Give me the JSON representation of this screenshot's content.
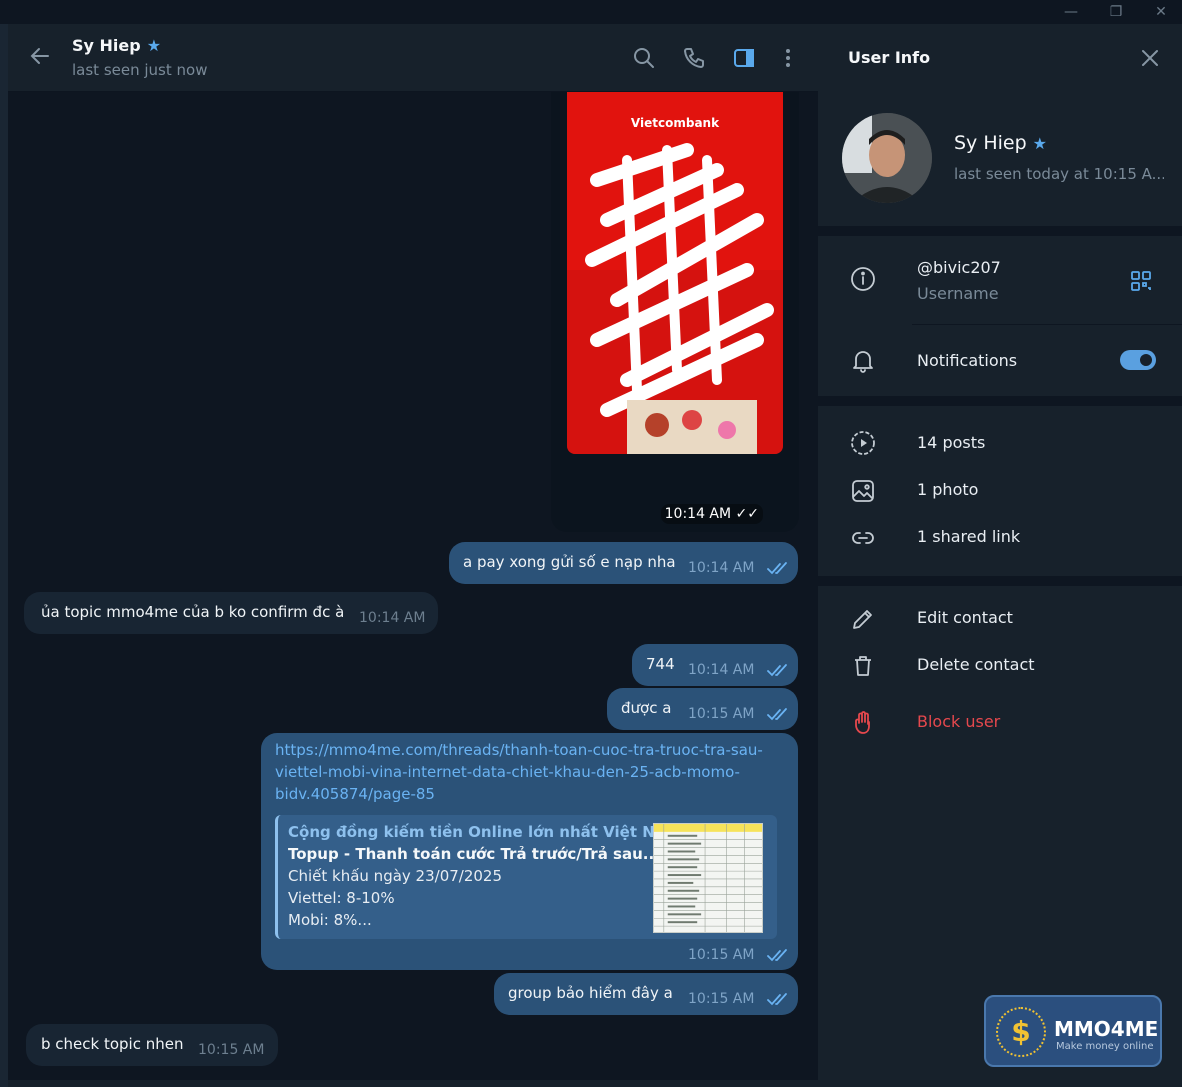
{
  "window": {
    "minimize": "—",
    "restore": "❐",
    "close": "✕"
  },
  "chat_header": {
    "name": "Sy Hiep",
    "status": "last seen just now"
  },
  "messages": [
    {
      "type": "media",
      "direction": "out",
      "brand": "Vietcombank",
      "time": "10:14 AM"
    },
    {
      "type": "text",
      "direction": "out",
      "text": "a pay xong gửi số e nạp nha",
      "time": "10:14 AM"
    },
    {
      "type": "text",
      "direction": "in",
      "text": "ủa topic mmo4me của b ko confirm đc à",
      "time": "10:14 AM"
    },
    {
      "type": "text",
      "direction": "out",
      "text": "744",
      "time": "10:14 AM"
    },
    {
      "type": "text",
      "direction": "out",
      "text": "được a",
      "time": "10:15 AM"
    },
    {
      "type": "link",
      "direction": "out",
      "url_lines": [
        "https://mmo4me.com/threads/thanh-toan-cuoc-tra-truoc-tra-sau-",
        "viettel-mobi-vina-internet-data-chiet-khau-den-25-acb-momo-",
        "bidv.405874/page-85"
      ],
      "preview": {
        "site": "Cộng đồng kiếm tiền Online lớn nhất Việt Nam",
        "title": "Topup - Thanh toán cước Trả trước/Trả sau...",
        "lines": [
          "Chiết khấu ngày 23/07/2025",
          "Viettel: 8-10%",
          "Mobi: 8%..."
        ]
      },
      "time": "10:15 AM"
    },
    {
      "type": "text",
      "direction": "out",
      "text": "group bảo hiểm đây a",
      "time": "10:15 AM"
    },
    {
      "type": "text",
      "direction": "in",
      "text": "b check topic nhen",
      "time": "10:15 AM"
    }
  ],
  "watermark": {
    "name": "MMO4ME",
    "tagline": "Make money online",
    "symbol": "$"
  },
  "user_info": {
    "title": "User Info",
    "name": "Sy Hiep",
    "status": "last seen today at 10:15 A...",
    "username": "@bivic207",
    "username_label": "Username",
    "notifications_label": "Notifications",
    "notifications_on": true,
    "posts": "14 posts",
    "photos": "1 photo",
    "links": "1 shared link",
    "edit": "Edit contact",
    "delete": "Delete contact",
    "block": "Block user"
  },
  "colors": {
    "accent": "#5aa9ec",
    "outgoing_bubble": "#2b5278",
    "incoming_bubble": "#182533",
    "danger": "#e5484d"
  }
}
